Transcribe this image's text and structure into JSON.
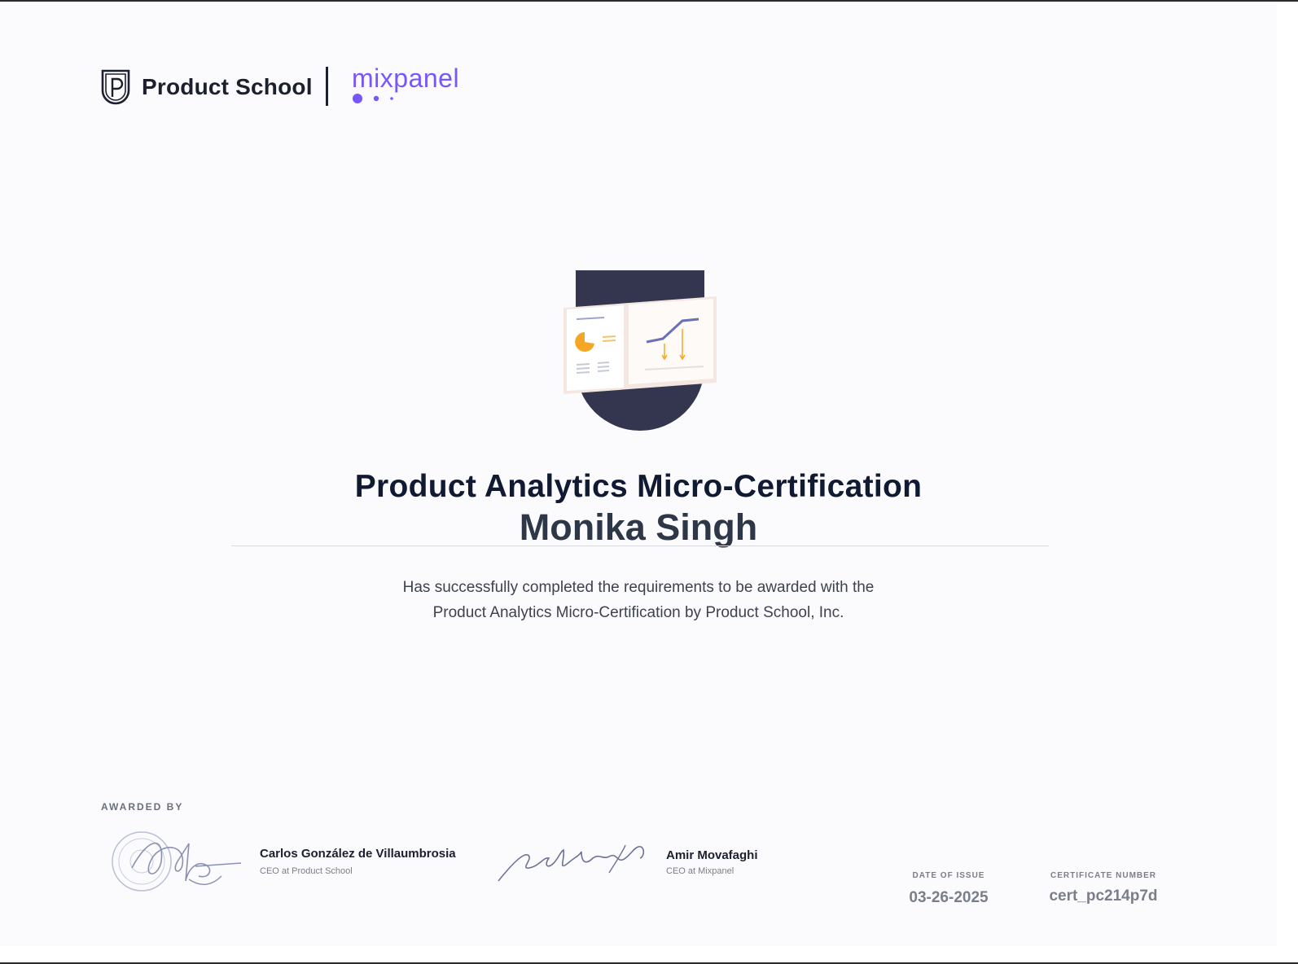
{
  "header": {
    "logo_primary": "Product School",
    "logo_secondary": "mixpanel"
  },
  "badge": {
    "icon": "analytics-badge-icon"
  },
  "certificate": {
    "title": "Product Analytics Micro-Certification",
    "recipient": "Monika Singh",
    "description_line1": "Has successfully completed the requirements to be awarded with the",
    "description_line2": "Product Analytics Micro-Certification by Product School, Inc."
  },
  "footer": {
    "awarded_by_label": "AWARDED BY",
    "signers": [
      {
        "name": "Carlos González de Villaumbrosia",
        "role": "CEO at Product School"
      },
      {
        "name": "Amir Movafaghi",
        "role": "CEO at Mixpanel"
      }
    ],
    "date_label": "DATE OF ISSUE",
    "date_value": "03-26-2025",
    "number_label": "CERTIFICATE NUMBER",
    "number_value": "cert_pc214p7d"
  },
  "colors": {
    "brand_dark": "#1b1f2e",
    "mixpanel_purple": "#7856ff",
    "badge_navy": "#34364f",
    "accent_orange": "#f5a623"
  }
}
